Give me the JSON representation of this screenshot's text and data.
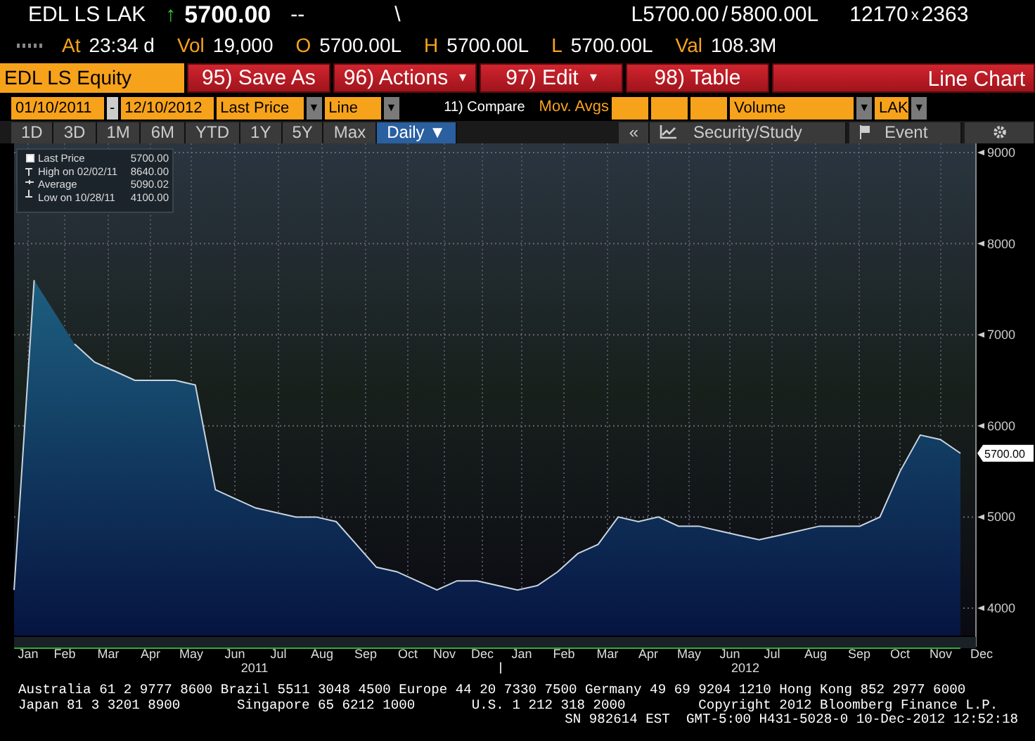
{
  "quote": {
    "ticker": "EDL LS LAK",
    "arrow": "↑",
    "last": "5700.00",
    "change": "--",
    "tick": "\\",
    "bid": "L5700.00",
    "slash": "/",
    "ask": "5800.00L",
    "bid_size": "12170",
    "times": "x",
    "ask_size": "2363"
  },
  "stats": [
    {
      "label": "At",
      "value": "23:34  d"
    },
    {
      "label": "Vol",
      "value": "19,000"
    },
    {
      "label": "O",
      "value": "5700.00L"
    },
    {
      "label": "H",
      "value": "5700.00L"
    },
    {
      "label": "L",
      "value": "5700.00L"
    },
    {
      "label": "Val",
      "value": "108.3M"
    }
  ],
  "security": "EDL LS Equity",
  "menu_buttons": [
    {
      "label": "95) Save As"
    },
    {
      "label": "96) Actions",
      "caret": "▾"
    },
    {
      "label": "97) Edit",
      "caret": "▾"
    },
    {
      "label": "98) Table"
    }
  ],
  "view_title": "Line Chart",
  "start_date": "01/10/2011",
  "date_sep": "-",
  "end_date": "12/10/2012",
  "field": {
    "value": "Last Price",
    "arrow": "▼"
  },
  "chart_style": {
    "value": "Line",
    "arrow": "▼"
  },
  "compare": "11) Compare",
  "mov_avgs": "Mov. Avgs",
  "lower_study": {
    "value": "Volume",
    "arrow": "▼"
  },
  "currency": {
    "value": "LAK",
    "arrow": "▼"
  },
  "periods": [
    {
      "label": "1D",
      "selected": false
    },
    {
      "label": "3D",
      "selected": false
    },
    {
      "label": "1M",
      "selected": false
    },
    {
      "label": "6M",
      "selected": false
    },
    {
      "label": "YTD",
      "selected": false
    },
    {
      "label": "1Y",
      "selected": false
    },
    {
      "label": "5Y",
      "selected": false
    },
    {
      "label": "Max",
      "selected": false
    },
    {
      "label": "Daily ▼",
      "selected": true
    }
  ],
  "collapse": "«",
  "security_study": "Security/Study",
  "event": "Event",
  "legend": [
    {
      "value": "5700.00"
    },
    {
      "label": "High on 02/02/11",
      "value": "8640.00"
    },
    {
      "label": "Average",
      "value": "5090.02"
    },
    {
      "label": "Low on 10/28/11",
      "value": "4100.00"
    }
  ],
  "last_tag": "5700.00",
  "month_labels": [
    "Jan",
    "Feb",
    "Mar",
    "Apr",
    "May",
    "Jun",
    "Jul",
    "Aug",
    "Sep",
    "Oct",
    "Nov",
    "Dec",
    "Jan",
    "Feb",
    "Mar",
    "Apr",
    "May",
    "Jun",
    "Jul",
    "Aug",
    "Sep",
    "Oct",
    "Nov",
    "Dec"
  ],
  "chart_data": {
    "type": "area",
    "grid": true,
    "yticks": [
      4000,
      5000,
      6000,
      7000,
      8000,
      9000
    ],
    "ylim": [
      3700,
      9100
    ],
    "series": [
      {
        "name": "Last Price",
        "color": "#c8d4e0",
        "values": [
          4200,
          7600,
          null,
          6900,
          6700,
          6600,
          6500,
          6500,
          6500,
          6450,
          5300,
          5200,
          5100,
          5050,
          5000,
          5000,
          4950,
          4700,
          4450,
          4400,
          4300,
          4200,
          4300,
          4300,
          4250,
          4200,
          4250,
          4400,
          4600,
          4700,
          5000,
          4950,
          5000,
          4900,
          4900,
          4850,
          4800,
          4750,
          4800,
          4850,
          4900,
          4900,
          4900,
          5000,
          5500,
          5900,
          5850,
          5700
        ]
      }
    ]
  },
  "years": [
    "2011",
    "2012"
  ],
  "footer": [
    "Australia 61 2 9777 8600 Brazil 5511 3048 4500 Europe 44 20 7330 7500 Germany 49 69 9204 1210 Hong Kong 852 2977 6000",
    "Japan 81 3 3201 8900       Singapore 65 6212 1000       U.S. 1 212 318 2000         Copyright 2012 Bloomberg Finance L.P.",
    "SN 982614 EST  GMT-5:00 H431-5028-0 10-Dec-2012 12:52:18"
  ]
}
